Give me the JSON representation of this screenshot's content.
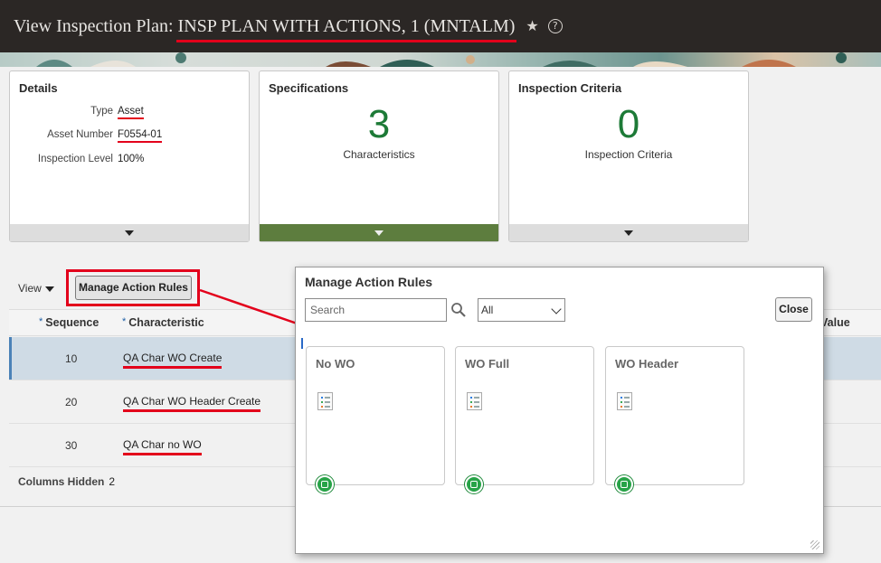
{
  "header": {
    "title_prefix": "View Inspection Plan:",
    "plan_name": "INSP PLAN WITH ACTIONS, 1 (MNTALM)",
    "favorite_icon": "star-icon",
    "help_icon": "help-icon",
    "help_glyph": "?"
  },
  "tiles": {
    "details": {
      "title": "Details",
      "rows": [
        {
          "label": "Type",
          "value": "Asset"
        },
        {
          "label": "Asset Number",
          "value": "F0554-01"
        },
        {
          "label": "Inspection Level",
          "value": "100%"
        }
      ]
    },
    "specifications": {
      "title": "Specifications",
      "count": "3",
      "caption": "Characteristics"
    },
    "criteria": {
      "title": "Inspection Criteria",
      "count": "0",
      "caption": "Inspection Criteria"
    }
  },
  "toolbar": {
    "view_label": "View",
    "manage_action_rules_label": "Manage Action Rules"
  },
  "table": {
    "columns": {
      "sequence": "Sequence",
      "characteristic": "Characteristic",
      "value": "Value",
      "required_mark": "*"
    },
    "rows": [
      {
        "sequence": "10",
        "characteristic": "QA Char WO Create",
        "selected": true
      },
      {
        "sequence": "20",
        "characteristic": "QA Char WO Header Create",
        "selected": false
      },
      {
        "sequence": "30",
        "characteristic": "QA Char no WO",
        "selected": false
      }
    ],
    "columns_hidden_label": "Columns Hidden",
    "columns_hidden_count": "2"
  },
  "dialog": {
    "title": "Manage Action Rules",
    "search_placeholder": "Search",
    "filter_value": "All",
    "close_label": "Close",
    "cards": [
      {
        "name": "No WO"
      },
      {
        "name": "WO Full"
      },
      {
        "name": "WO Header"
      }
    ]
  },
  "colors": {
    "header_bg": "#2b2725",
    "accent_green": "#1d7a37",
    "annotation_red": "#e3001b",
    "selected_row": "#cfdbe5"
  }
}
